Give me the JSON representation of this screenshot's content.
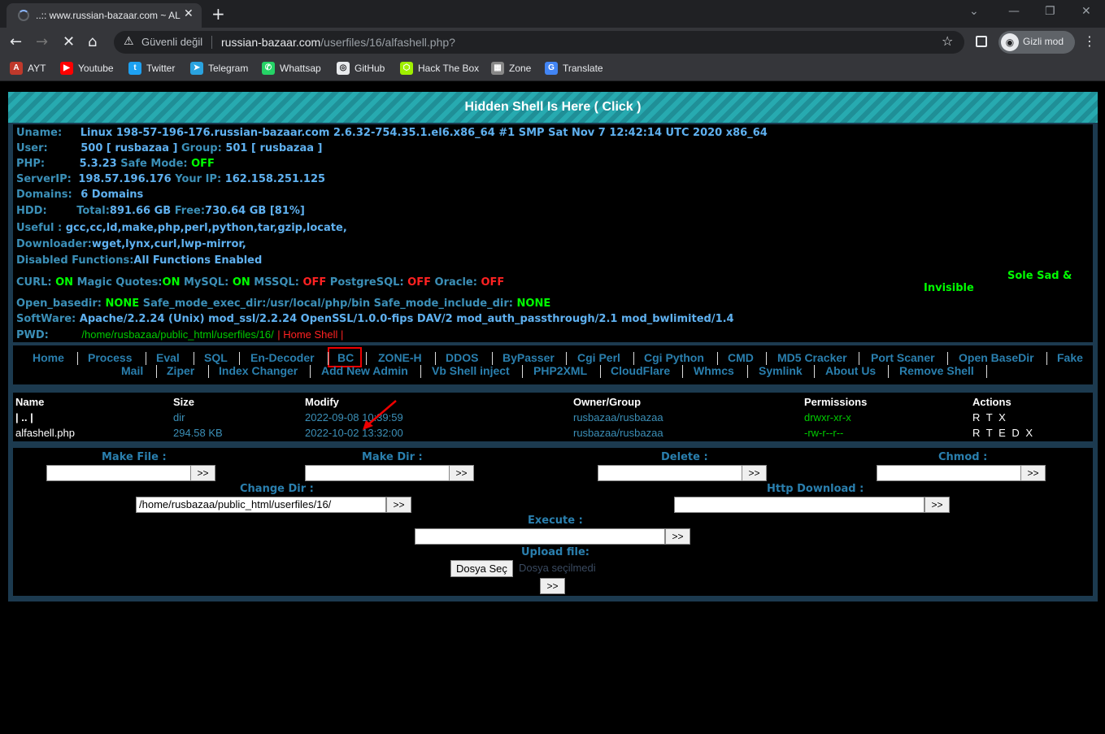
{
  "browser": {
    "tab_title": "..:: www.russian-bazaar.com ~ ALFA",
    "address_warning": "Güvenli değil",
    "url_host": "russian-bazaar.com",
    "url_path": "/userfiles/16/alfashell.php?",
    "incognito_label": "Gizli mod",
    "bookmarks": [
      {
        "label": "AYT",
        "icon": "ayt-icon",
        "color": "#c0392b"
      },
      {
        "label": "Youtube",
        "icon": "youtube-icon",
        "color": "#ff0000"
      },
      {
        "label": "Twitter",
        "icon": "twitter-icon",
        "color": "#1da1f2"
      },
      {
        "label": "Telegram",
        "icon": "telegram-icon",
        "color": "#2aa3df"
      },
      {
        "label": "Whattsap",
        "icon": "whatsapp-icon",
        "color": "#25d366"
      },
      {
        "label": "GitHub",
        "icon": "github-icon",
        "color": "#e8eaed"
      },
      {
        "label": "Hack The Box",
        "icon": "hackthebox-icon",
        "color": "#9fef00"
      },
      {
        "label": "Zone",
        "icon": "zone-icon",
        "color": "#888888"
      },
      {
        "label": "Translate",
        "icon": "translate-icon",
        "color": "#4285f4"
      }
    ]
  },
  "shell": {
    "banner": "Hidden Shell Is Here ( Click )",
    "info": {
      "uname_label": "Uname:",
      "uname": "Linux 198-57-196-176.russian-bazaar.com 2.6.32-754.35.1.el6.x86_64 #1 SMP Sat Nov 7 12:42:14 UTC 2020 x86_64",
      "user_label": "User:",
      "user": "500 [ rusbazaa ]",
      "group_label": "Group:",
      "group": "501 [ rusbazaa ]",
      "php_label": "PHP:",
      "php_version": "5.3.23",
      "safe_mode_label": "Safe Mode:",
      "safe_mode": "OFF",
      "serverip_label": "ServerIP:",
      "server_ip": "198.57.196.176",
      "your_ip_label": "Your IP:",
      "your_ip": "162.158.251.125",
      "domains_label": "Domains:",
      "domains": "6 Domains",
      "hdd_label": "HDD:",
      "hdd_total_label": "Total:",
      "hdd_total": "891.66 GB",
      "hdd_free_label": "Free:",
      "hdd_free": "730.64 GB [81%]",
      "useful_label": "Useful :",
      "useful": "gcc,cc,ld,make,php,perl,python,tar,gzip,locate,",
      "downloader_label": "Downloader:",
      "downloader": "wget,lynx,curl,lwp-mirror,",
      "disabled_label": "Disabled Functions:",
      "disabled": "All Functions Enabled",
      "curl_label": "CURL:",
      "curl": "ON",
      "magic_label": "Magic Quotes:",
      "magic": "ON",
      "mysql_label": "MySQL:",
      "mysql": "ON",
      "mssql_label": "MSSQL:",
      "mssql": "OFF",
      "postgres_label": "PostgreSQL:",
      "postgres": "OFF",
      "oracle_label": "Oracle:",
      "oracle": "OFF",
      "open_basedir_label": "Open_basedir:",
      "open_basedir": "NONE",
      "exec_dir_label": "Safe_mode_exec_dir:",
      "exec_dir": "/usr/local/php/bin",
      "include_dir_label": "Safe_mode_include_dir:",
      "include_dir": "NONE",
      "software_label": "SoftWare:",
      "software": "Apache/2.2.24 (Unix) mod_ssl/2.2.24 OpenSSL/1.0.0-fips DAV/2 mod_auth_passthrough/2.1 mod_bwlimited/1.4",
      "pwd_label": "PWD:",
      "pwd": "/home/rusbazaa/public_html/userfiles/16/",
      "home_shell": "| Home Shell |",
      "side_text_1": "Sole Sad &",
      "side_text_2": "Invisible"
    },
    "menu_row1": [
      "Home",
      "Process",
      "Eval",
      "SQL",
      "En-Decoder",
      "BC",
      "ZONE-H",
      "DDOS",
      "ByPasser",
      "Cgi Perl",
      "Cgi Python",
      "CMD",
      "MD5 Cracker",
      "Port Scaner",
      "Open BaseDir",
      "Fake"
    ],
    "menu_row2": [
      "Mail",
      "Ziper",
      "Index Changer",
      "Add New Admin",
      "Vb Shell inject",
      "PHP2XML",
      "CloudFlare",
      "Whmcs",
      "Symlink",
      "About Us",
      "Remove Shell"
    ],
    "file_headers": [
      "Name",
      "Size",
      "Modify",
      "Owner/Group",
      "Permissions",
      "Actions"
    ],
    "files": [
      {
        "name": "| .. |",
        "size": "dir",
        "modify": "2022-09-08 10:39:59",
        "owner": "rusbazaa/rusbazaa",
        "perms": "drwxr-xr-x",
        "actions": "R T X"
      },
      {
        "name": "alfashell.php",
        "size": "294.58 KB",
        "modify": "2022-10-02 13:32:00",
        "owner": "rusbazaa/rusbazaa",
        "perms": "-rw-r--r--",
        "actions": "R T E D X"
      }
    ],
    "tools": {
      "make_file": "Make File :",
      "make_dir": "Make Dir :",
      "delete": "Delete :",
      "chmod": "Chmod :",
      "change_dir": "Change Dir :",
      "change_dir_value": "/home/rusbazaa/public_html/userfiles/16/",
      "http_download": "Http Download :",
      "execute": "Execute :",
      "upload": "Upload file:",
      "choose_file": "Dosya Seç",
      "no_file": "Dosya seçilmedi",
      "go": ">>"
    }
  }
}
